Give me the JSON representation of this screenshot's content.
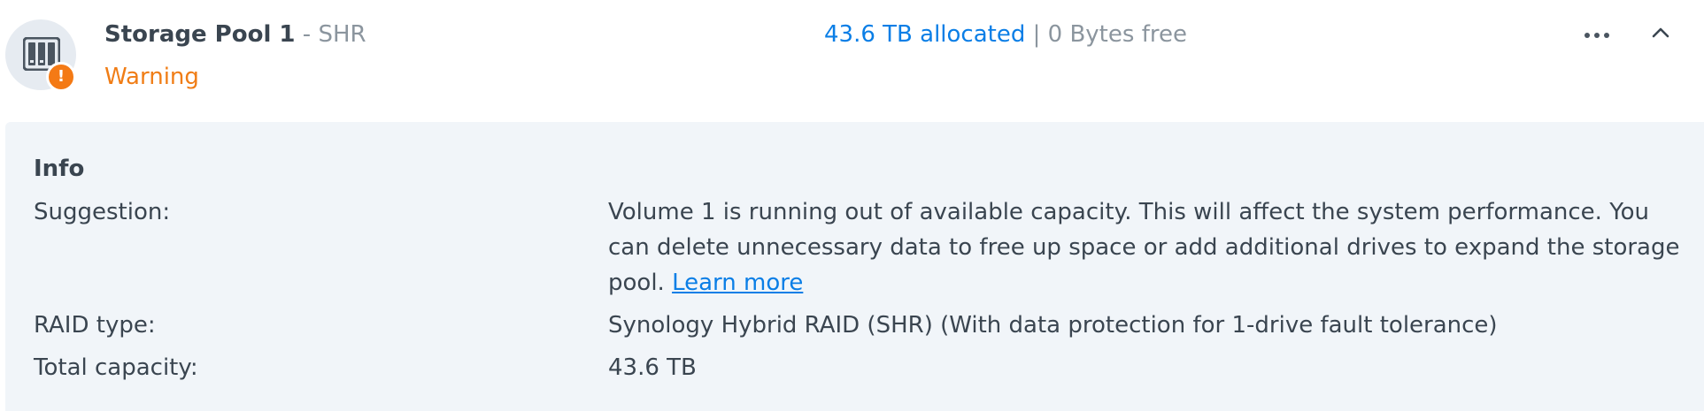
{
  "pool": {
    "name": "Storage Pool 1",
    "separator": " - ",
    "type": "SHR",
    "status": "Warning",
    "status_badge": "!",
    "icon": "nas-drives-icon",
    "warning_color": "#f47a15"
  },
  "capacity": {
    "allocated": "43.6 TB allocated",
    "pipe": " | ",
    "free": "0 Bytes free",
    "link_color": "#0a7ee6"
  },
  "actions": {
    "more_icon": "more-horizontal-icon",
    "collapse_icon": "chevron-up-icon"
  },
  "info": {
    "title": "Info",
    "suggestion_label": "Suggestion:",
    "suggestion_text": "Volume 1 is running out of available capacity. This will affect the system performance. You can delete unnecessary data to free up space or add additional drives to expand the storage pool. ",
    "learn_more": "Learn more",
    "raid_label": "RAID type:",
    "raid_value": "Synology Hybrid RAID (SHR) (With data protection for 1-drive fault tolerance)",
    "capacity_label": "Total capacity:",
    "capacity_value": "43.6 TB"
  }
}
